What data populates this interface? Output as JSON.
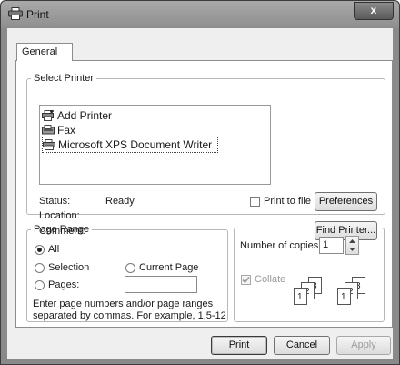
{
  "window": {
    "title": "Print",
    "close_glyph": "x"
  },
  "tabs": [
    {
      "label": "General"
    }
  ],
  "select_printer": {
    "legend": "Select Printer",
    "printers": [
      {
        "name": "Add Printer",
        "icon": "add-printer-icon"
      },
      {
        "name": "Fax",
        "icon": "fax-icon"
      },
      {
        "name": "Microsoft XPS Document Writer",
        "icon": "printer-icon",
        "selected": true
      }
    ],
    "status_label": "Status:",
    "status_value": "Ready",
    "location_label": "Location:",
    "comment_label": "Comment:",
    "print_to_file_label": "Print to file",
    "print_to_file_checked": false,
    "preferences_label": "Preferences",
    "find_printer_label": "Find Printer..."
  },
  "page_range": {
    "legend": "Page Range",
    "options": [
      {
        "label": "All",
        "checked": true
      },
      {
        "label": "Selection",
        "checked": false
      },
      {
        "label": "Current Page",
        "checked": false
      },
      {
        "label": "Pages:",
        "checked": false
      }
    ],
    "pages_value": "",
    "help_line1": "Enter page numbers and/or page ranges",
    "help_line2": "separated by commas.  For example, 1,5-12"
  },
  "copies": {
    "label": "Number of copies:",
    "value": "1",
    "collate_label": "Collate",
    "collate_checked": true,
    "collate_disabled": true
  },
  "buttons": {
    "print": "Print",
    "cancel": "Cancel",
    "apply": "Apply"
  }
}
